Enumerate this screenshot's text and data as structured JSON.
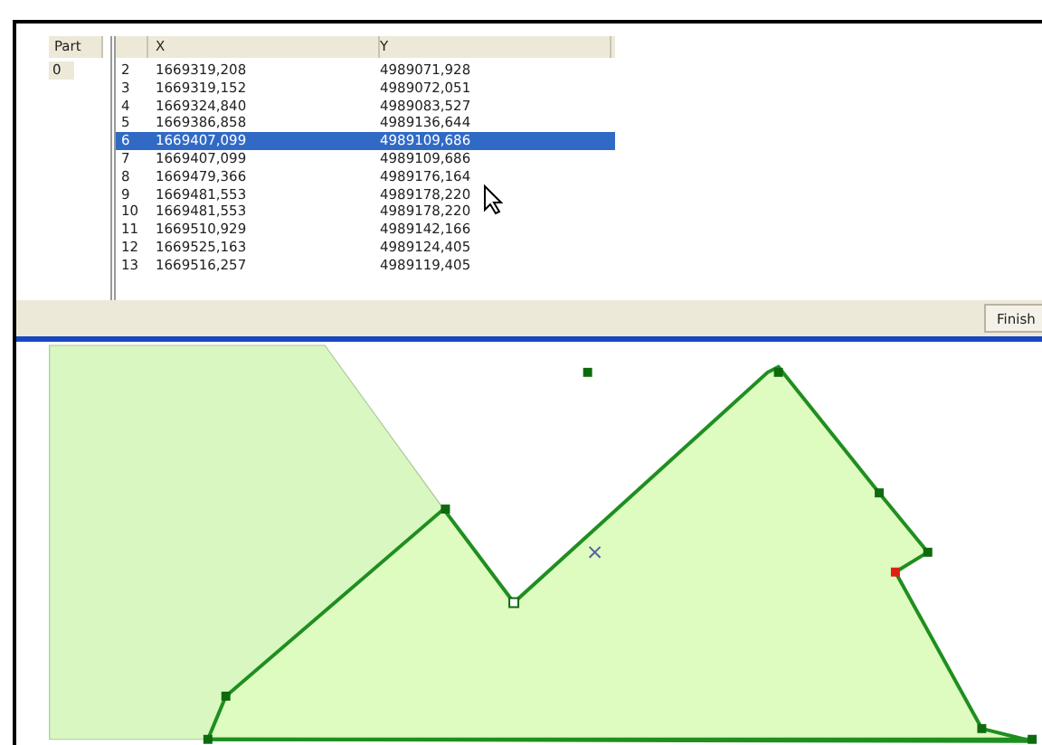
{
  "parts": {
    "header": "Part",
    "items": [
      {
        "label": "0",
        "selected": true
      }
    ]
  },
  "table": {
    "columns": [
      "",
      "X",
      "Y"
    ],
    "rows": [
      {
        "cells": [
          "2",
          "1669319,208",
          "4989071,928"
        ],
        "selected": false
      },
      {
        "cells": [
          "3",
          "1669319,152",
          "4989072,051"
        ],
        "selected": false
      },
      {
        "cells": [
          "4",
          "1669324,840",
          "4989083,527"
        ],
        "selected": false
      },
      {
        "cells": [
          "5",
          "1669386,858",
          "4989136,644"
        ],
        "selected": false
      },
      {
        "cells": [
          "6",
          "1669407,099",
          "4989109,686"
        ],
        "selected": true
      },
      {
        "cells": [
          "7",
          "1669407,099",
          "4989109,686"
        ],
        "selected": false
      },
      {
        "cells": [
          "8",
          "1669479,366",
          "4989176,164"
        ],
        "selected": false
      },
      {
        "cells": [
          "9",
          "1669481,553",
          "4989178,220"
        ],
        "selected": false
      },
      {
        "cells": [
          "10",
          "1669481,553",
          "4989178,220"
        ],
        "selected": false
      },
      {
        "cells": [
          "11",
          "1669510,929",
          "4989142,166"
        ],
        "selected": false
      },
      {
        "cells": [
          "12",
          "1669525,163",
          "4989124,405"
        ],
        "selected": false
      },
      {
        "cells": [
          "13",
          "1669516,257",
          "4989119,405"
        ],
        "selected": false
      }
    ]
  },
  "finish_button": "Finish"
}
